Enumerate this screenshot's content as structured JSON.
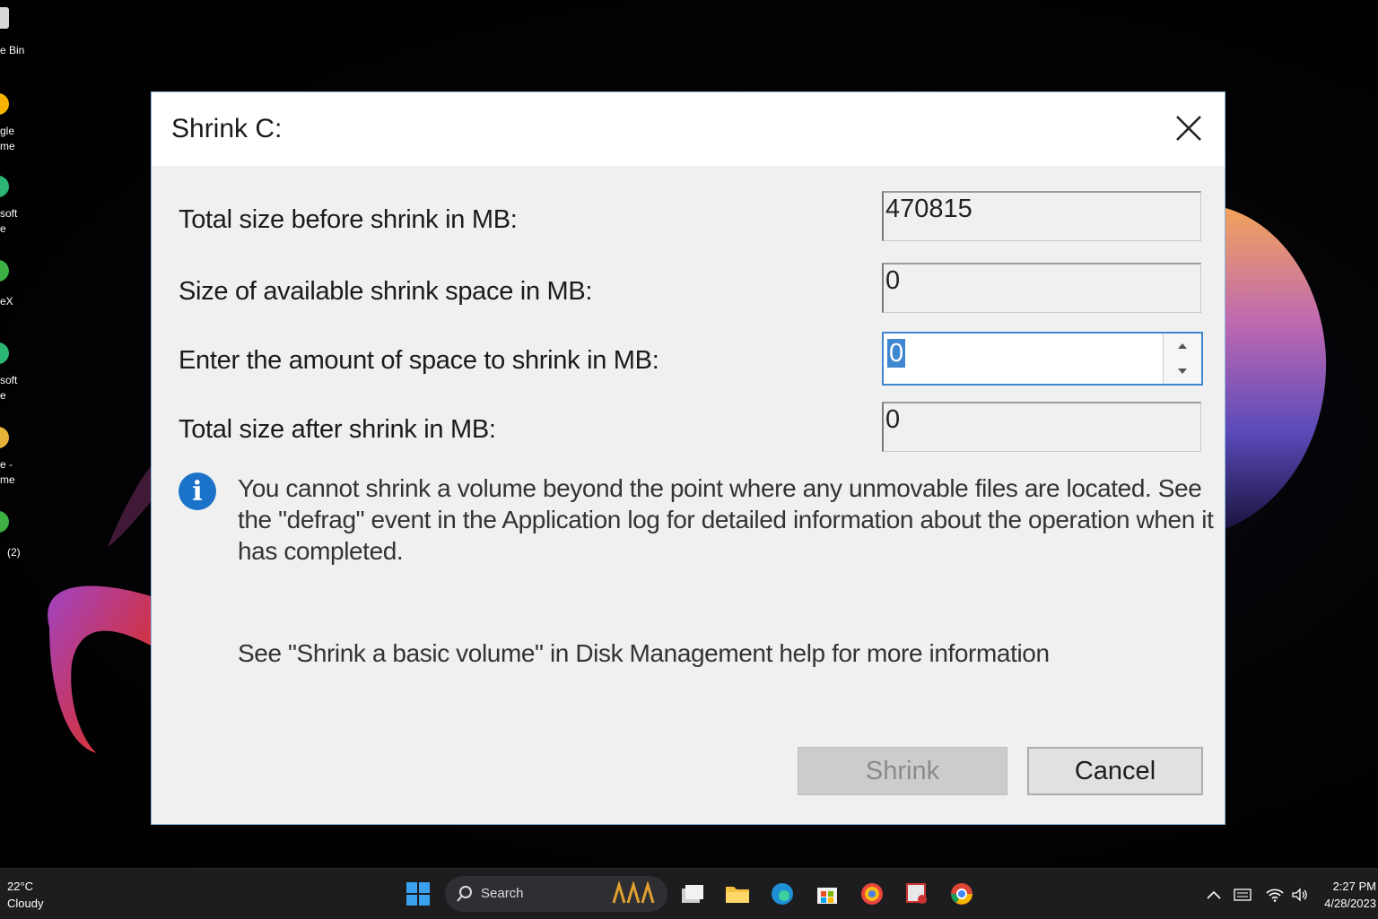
{
  "desktop": {
    "icons": [
      {
        "label": "e Bin"
      },
      {
        "label": "gle\nme"
      },
      {
        "label": "soft\ne"
      },
      {
        "label": "eX"
      },
      {
        "label": "soft\ne"
      },
      {
        "label": "e -\nme"
      },
      {
        "label": "(2)"
      }
    ]
  },
  "dialog": {
    "title": "Shrink C:",
    "rows": [
      {
        "label": "Total size before shrink in MB:",
        "value": "470815"
      },
      {
        "label": "Size of available shrink space in MB:",
        "value": "0"
      },
      {
        "label": "Enter the amount of space to shrink in MB:",
        "value": "0"
      },
      {
        "label": "Total size after shrink in MB:",
        "value": "0"
      }
    ],
    "info_text": "You cannot shrink a volume beyond the point where any unmovable files are located. See the \"defrag\" event in the Application log for detailed information about the operation when it has completed.",
    "help_text": "See \"Shrink a basic volume\" in Disk Management help for more information",
    "shrink_label": "Shrink",
    "cancel_label": "Cancel"
  },
  "taskbar": {
    "weather_temp": "22°C",
    "weather_desc": "Cloudy",
    "search_label": "Search",
    "clock_time": "2:27 PM",
    "clock_date": "4/28/2023"
  },
  "colors": {
    "accent": "#3f87d0",
    "info_blue": "#1a73c9",
    "taskbar": "#1d1d1f"
  }
}
